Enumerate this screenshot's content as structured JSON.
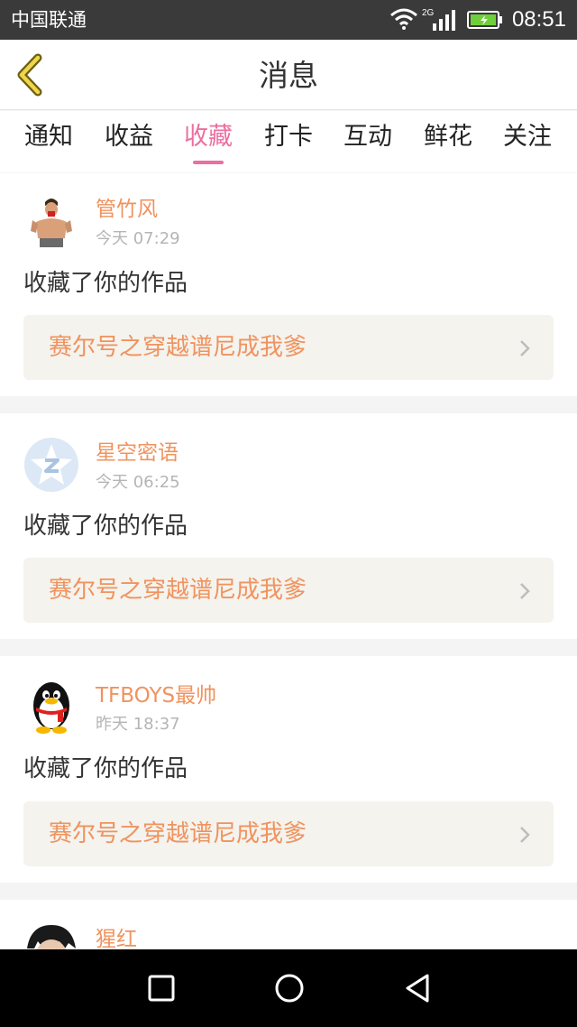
{
  "status_bar": {
    "carrier": "中国联通",
    "network": "2G",
    "time": "08:51"
  },
  "header": {
    "title": "消息",
    "back_icon": "chevron-left-icon",
    "accent_color": "#c8a42a"
  },
  "tabs": [
    {
      "label": "通知",
      "active": false
    },
    {
      "label": "收益",
      "active": false
    },
    {
      "label": "收藏",
      "active": true
    },
    {
      "label": "打卡",
      "active": false
    },
    {
      "label": "互动",
      "active": false
    },
    {
      "label": "鲜花",
      "active": false
    },
    {
      "label": "关注",
      "active": false
    }
  ],
  "colors": {
    "tab_active": "#ec6fa0",
    "username": "#f0935e",
    "work_title": "#f0935e",
    "work_bg": "#f4f3ee"
  },
  "messages": [
    {
      "username": "管竹风",
      "time": "今天 07:29",
      "action": "收藏了你的作品",
      "work": "赛尔号之穿越谱尼成我爹",
      "avatar": "avatar-man-icon"
    },
    {
      "username": "星空密语",
      "time": "今天 06:25",
      "action": "收藏了你的作品",
      "work": "赛尔号之穿越谱尼成我爹",
      "avatar": "avatar-default-icon"
    },
    {
      "username": "TFBOYS最帅",
      "time": "昨天 18:37",
      "action": "收藏了你的作品",
      "work": "赛尔号之穿越谱尼成我爹",
      "avatar": "avatar-penguin-icon"
    },
    {
      "username": "猩红",
      "avatar": "avatar-dark-hair-icon"
    }
  ]
}
